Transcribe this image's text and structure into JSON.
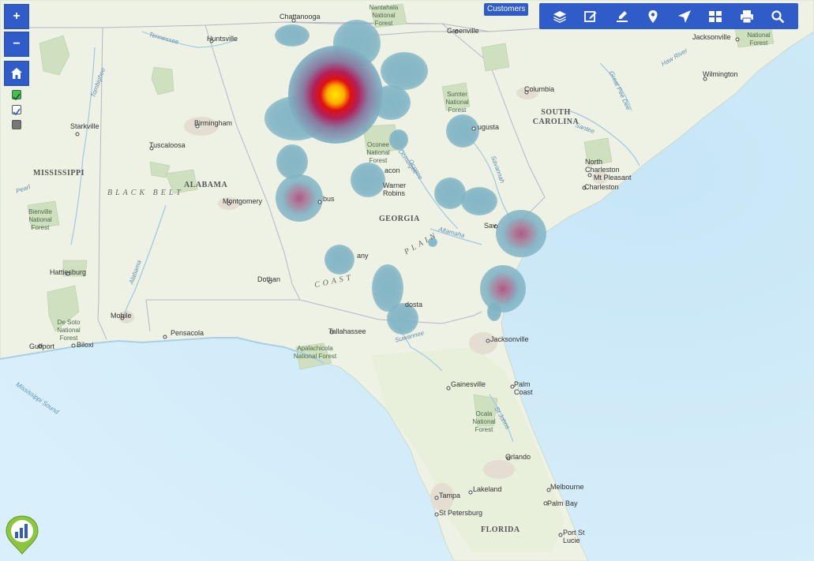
{
  "map": {
    "layer_label": "Customers",
    "toolbar": {
      "icons": [
        "layers-icon",
        "edit-icon",
        "draw-icon",
        "pin-icon",
        "navigate-icon",
        "grid-icon",
        "print-icon",
        "search-icon"
      ]
    },
    "zoom": {
      "in_label": "+",
      "out_label": "−"
    },
    "home_icon": "home-icon",
    "legend_checks": [
      "green-check",
      "blue-check",
      "gray-box"
    ],
    "colors": {
      "water": "#d4ecfb",
      "land": "#eef2e4",
      "toolbar": "#2f5cc8",
      "heat_low": "#7fb3c4",
      "heat_mid": "#a0326e",
      "heat_high": "#ff2a00",
      "heat_peak": "#ffe800"
    },
    "states": [
      "MISSISSIPPI",
      "ALABAMA",
      "GEORGIA",
      "SOUTH CAROLINA",
      "FLORIDA"
    ],
    "regions": [
      "BLACK BELT",
      "COAST",
      "PLAIN"
    ],
    "cities": [
      "Chattanooga",
      "Huntsville",
      "Greenville",
      "Jacksonville",
      "Wilmington",
      "Columbia",
      "Starkville",
      "Birmingham",
      "Tuscaloosa",
      "Augusta",
      "Montgomery",
      "Macon",
      "Warner Robins",
      "North Charleston",
      "Mt Pleasant",
      "Charleston",
      "Savannah",
      "Columbus",
      "Albany",
      "Hattiesburg",
      "Dothan",
      "Mobile",
      "Pensacola",
      "Tallahassee",
      "Valdosta",
      "Gulfport",
      "Biloxi",
      "Gainesville",
      "Palm Coast",
      "Orlando",
      "Tampa",
      "Lakeland",
      "Melbourne",
      "Palm Bay",
      "St Petersburg",
      "Port St Lucie"
    ],
    "forests": [
      "Nantahala National Forest",
      "Sumter National Forest",
      "Oconee National Forest",
      "Bienville National Forest",
      "De Soto National Forest",
      "Apalachicola National Forest",
      "Ocala National Forest",
      "Croatan National Forest"
    ],
    "waters": [
      "Tennessee",
      "Pearl",
      "Alabama",
      "Ocmulgee",
      "Oconee",
      "Altamaha",
      "Savannah",
      "Santee",
      "Great Pee Dee",
      "Haw River",
      "Suwannee",
      "Tombigbee",
      "Mississippi Sound",
      "St Johns"
    ],
    "labels_visible": {
      "Chattanooga": "Chattanooga",
      "Huntsville": "Huntsville",
      "Greenville": "Greenville",
      "Jacksonville_nc": "Jacksonville",
      "Wilmington": "Wilmington",
      "Columbia": "Columbia",
      "Starkville": "Starkville",
      "Birmingham": "Birmingham",
      "Tuscaloosa": "Tuscaloosa",
      "Augusta": "ugusta",
      "Montgomery": "Montgomery",
      "Macon": "acon",
      "WarnerRobins": "Warner\nRobins",
      "NorthCharleston": "North\nCharleston",
      "MtPleasant": "Mt Pleasant",
      "Charleston": "Charleston",
      "Savannah": "Sav",
      "Columbus": "bus",
      "Albany": "any",
      "Hattiesburg": "Hattiesburg",
      "Dothan": "Dothan",
      "Mobile": "Mobile",
      "Pensacola": "Pensacola",
      "Tallahassee": "Tallahassee",
      "Valdosta": "dosta",
      "Gulfport": "Gulfport",
      "Biloxi": "Biloxi",
      "Jacksonville_fl": "Jacksonville",
      "Gainesville": "Gainesville",
      "PalmCoast": "Palm\nCoast",
      "Orlando": "Orlando",
      "Tampa": "Tampa",
      "Lakeland": "Lakeland",
      "Melbourne": "Melbourne",
      "PalmBay": "Palm Bay",
      "StPetersburg": "St Petersburg",
      "PortStLucie": "Port St\nLucie"
    }
  }
}
